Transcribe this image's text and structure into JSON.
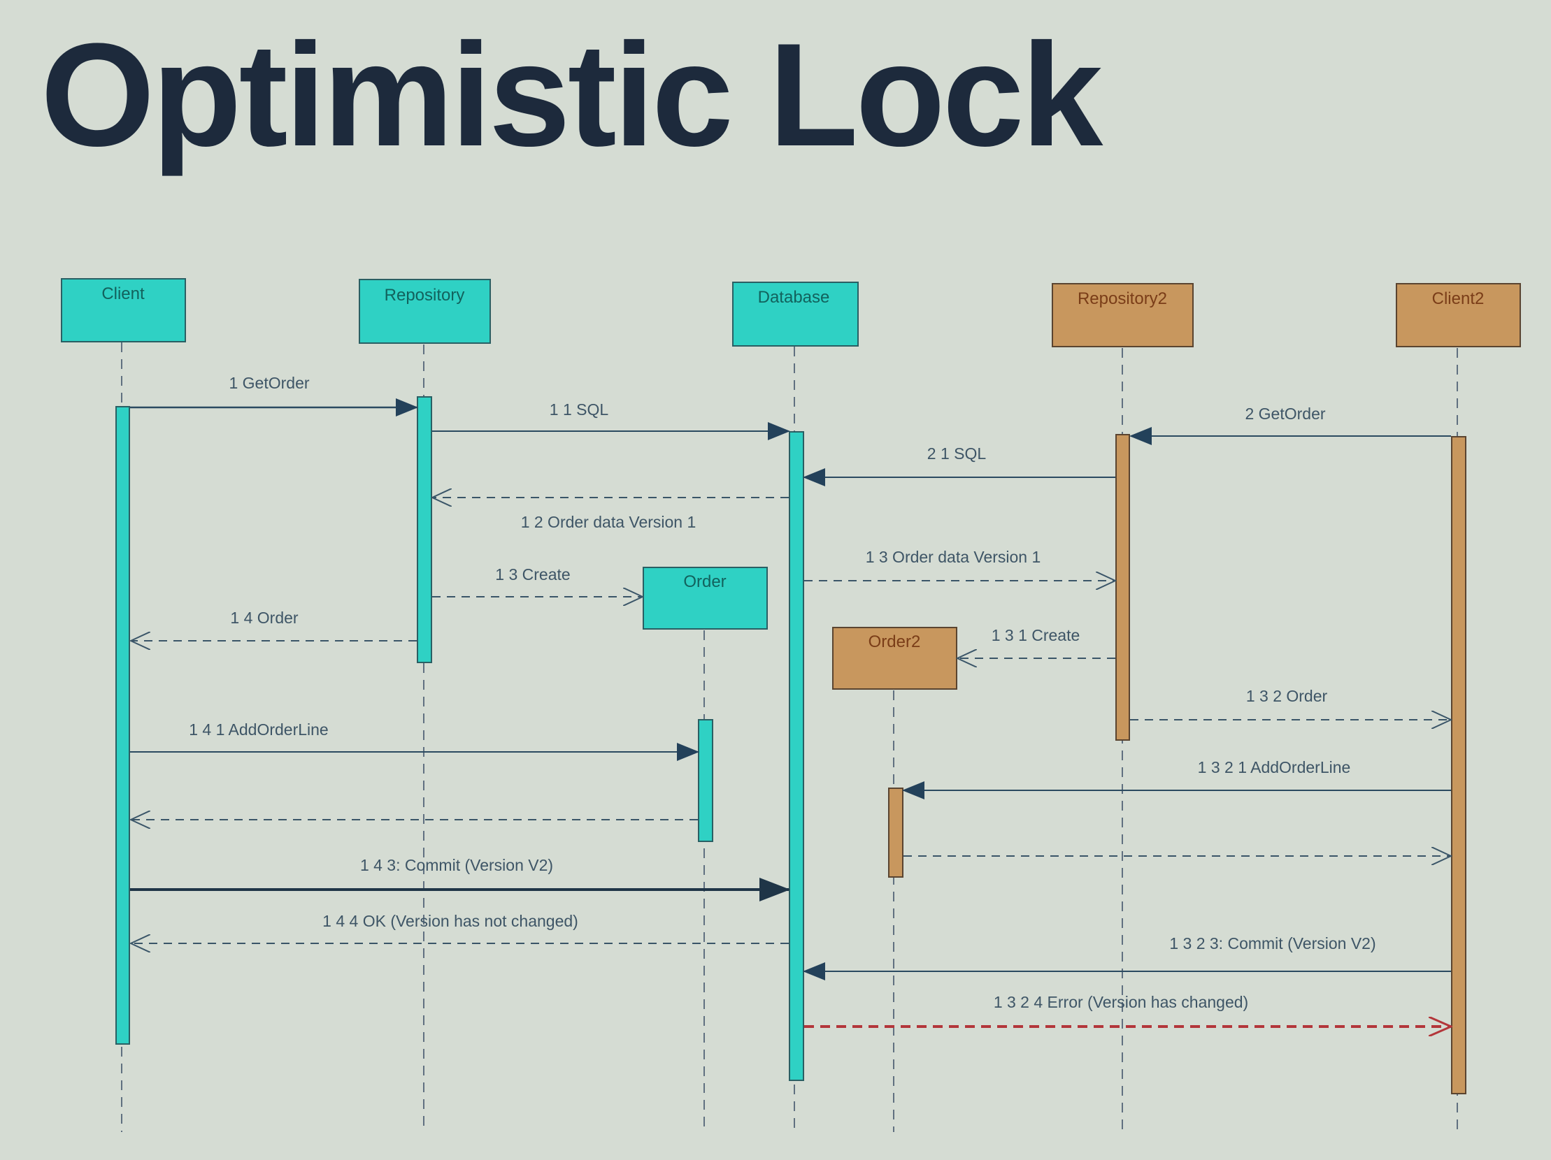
{
  "title": "Optimistic Lock",
  "colors": {
    "teal": "#2fd1c4",
    "brown": "#c8975e",
    "line": "#2b4a60",
    "error": "#b3363a",
    "teal_text": "#12625d",
    "brown_text": "#7a3d18",
    "label_text": "#3e5566"
  },
  "participants": [
    {
      "name": "Client",
      "color": "teal"
    },
    {
      "name": "Repository",
      "color": "teal"
    },
    {
      "name": "Database",
      "color": "teal"
    },
    {
      "name": "Repository2",
      "color": "brown"
    },
    {
      "name": "Client2",
      "color": "brown"
    },
    {
      "name": "Order",
      "color": "teal"
    },
    {
      "name": "Order2",
      "color": "brown"
    }
  ],
  "messages": [
    {
      "label": "1  GetOrder",
      "from": "Client",
      "to": "Repository",
      "kind": "sync"
    },
    {
      "label": "1 1  SQL",
      "from": "Repository",
      "to": "Database",
      "kind": "sync"
    },
    {
      "label": "1 2  Order data Version 1",
      "from": "Database",
      "to": "Repository",
      "kind": "reply"
    },
    {
      "label": "1 3  Create",
      "from": "Repository",
      "to": "Order",
      "kind": "create"
    },
    {
      "label": "1 4  Order",
      "from": "Repository",
      "to": "Client",
      "kind": "reply"
    },
    {
      "label": "1 4 1  AddOrderLine",
      "from": "Client",
      "to": "Order",
      "kind": "sync"
    },
    {
      "label": "",
      "from": "Order",
      "to": "Client",
      "kind": "reply"
    },
    {
      "label": "1 4 3: Commit (Version V2)",
      "from": "Client",
      "to": "Database",
      "kind": "sync"
    },
    {
      "label": "1 4 4  OK (Version has not changed)",
      "from": "Database",
      "to": "Client",
      "kind": "reply"
    },
    {
      "label": "2  GetOrder",
      "from": "Client2",
      "to": "Repository2",
      "kind": "sync"
    },
    {
      "label": "2 1  SQL",
      "from": "Repository2",
      "to": "Database",
      "kind": "sync"
    },
    {
      "label": "1 3  Order data Version 1",
      "from": "Database",
      "to": "Repository2",
      "kind": "reply"
    },
    {
      "label": "1 3 1  Create",
      "from": "Repository2",
      "to": "Order2",
      "kind": "create"
    },
    {
      "label": "1 3 2  Order",
      "from": "Repository2",
      "to": "Client2",
      "kind": "reply"
    },
    {
      "label": "1 3 2 1  AddOrderLine",
      "from": "Client2",
      "to": "Order2",
      "kind": "sync"
    },
    {
      "label": "",
      "from": "Order2",
      "to": "Client2",
      "kind": "reply"
    },
    {
      "label": "1 3 2 3: Commit (Version V2)",
      "from": "Client2",
      "to": "Database",
      "kind": "sync"
    },
    {
      "label": "1 3 2 4  Error (Version has changed)",
      "from": "Database",
      "to": "Client2",
      "kind": "error"
    }
  ]
}
